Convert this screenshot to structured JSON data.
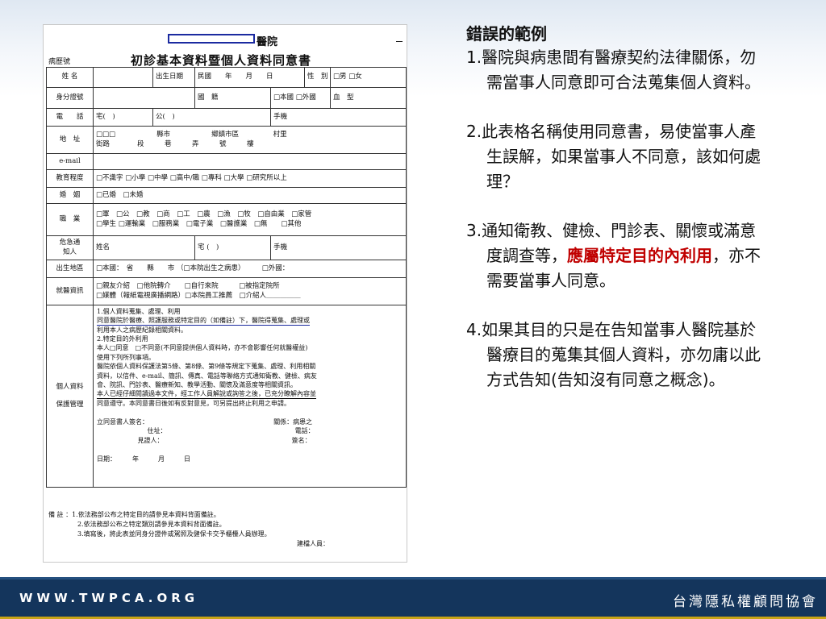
{
  "form": {
    "hospital_suffix": "醫院",
    "chart_no_label": "病歷號",
    "title": "初診基本資料暨個人資料同意書",
    "rows": {
      "name": {
        "label": "姓 名",
        "birth_label": "出生日期",
        "birth_value": "民國　　年　　月　　日",
        "sex_label": "性　別",
        "sex_options": "□男 □女"
      },
      "id": {
        "label": "身分證號",
        "nation_label": "國　籍",
        "nation_options": "□本國 □外國",
        "blood_label": "血　型"
      },
      "phone": {
        "label": "電　　話",
        "home": "宅(　)",
        "office": "公(　)",
        "mobile": "手機"
      },
      "address": {
        "label": "地　址",
        "line1": "□□□　　　　　　縣市　　　　　　鄉鎮市區　　　　　村里",
        "line2": "街路　　　　段　　　巷　　　弄　　　號　　　樓"
      },
      "email": {
        "label": "e-mail"
      },
      "education": {
        "label": "教育程度",
        "options": "□不識字 □小學 □中學 □高中/職 □專科 □大學 □研究所以上"
      },
      "marriage": {
        "label": "婚　姻",
        "options": "□已婚　□未婚"
      },
      "occupation": {
        "label": "職　業",
        "line1": "□軍　□公　□教　□商　□工　□農　□漁　□牧　□自由業　□家管",
        "line2": "□學生 □運輸業　□服務業　□電子業　□醫護業　□無　　□其他"
      },
      "emergency": {
        "label1": "危急通",
        "label2": "知人",
        "name_label": "姓名",
        "home_label": "宅",
        "home_value": "(　)",
        "mobile_label": "手機"
      },
      "birthplace": {
        "label": "出生地區",
        "value": "□本國：　省　　縣　　市 （□本院出生之病患）　　　□外國："
      },
      "consult": {
        "label": "就醫資訊",
        "line1": "□親友介紹　□他院轉介　　□自行來院　　　□被指定院所",
        "line2": "□媒體（報紙電視廣播網路）□本院員工推薦　□介紹人＿＿＿＿＿"
      },
      "pd": {
        "label1": "個人資料",
        "label2": "保護管理",
        "lines": [
          "1.個人資料蒐集、處理、利用",
          "同意醫院於醫療、照護服務或特定目的（如備註）下，醫院得蒐集、處理或",
          "利用本人之病歷紀錄相關資料。",
          "2.特定目的外利用",
          "本人□同意　□不同意(不同意提供個人資料時，亦不會影響任何就醫權益)",
          "使用下列所列事項。",
          "醫院依個人資料保護法第5條、第8條、第9條等規定下蒐集、處理、利用相關",
          "資料，以信件、e-mail、簡訊、傳真、電話等聯絡方式通知衛教、健檢、病友",
          "會、院訊、門診表、醫療新知、教學活動、關懷及滿意度等相關資訊。",
          "本人已經仔細閱讀過本文件，經工作人員解說或詢答之後，已充分瞭解內容並",
          "同意遵守。本同意書日後如有反對意見，可另提出終止利用之申請。"
        ],
        "signer_label": "立同意書人簽名：",
        "relation_label": "關係：病患之",
        "address_label": "住址：",
        "phone_label": "電話：",
        "witness_label": "見證人：",
        "sign_label": "簽名：",
        "date_label": "日期：　　　年　　　月　　　日"
      }
    },
    "notes": [
      "備 註 ：1.依法務部公布之特定目的請參見本資料背面備註。",
      "2.依法務部公布之特定類別請參見本資料背面備註。",
      "3.填寫後，將此表並同身分證件或駕照及健保卡交予櫃檯人員辦理。"
    ],
    "builder_label": "建檔人員："
  },
  "panel": {
    "heading": "錯誤的範例",
    "item1": "1.醫院與病患間有醫療契約法律關係，勿需當事人同意即可合法蒐集個人資料。",
    "item2": "2.此表格名稱使用同意書，易使當事人產生誤解，如果當事人不同意，該如何處理？",
    "item3_pre": "3.通知衛教、健檢、門診表、關懷或滿意度調查等，",
    "item3_hl": "應屬特定目的內利用",
    "item3_post": "，亦不需要當事人同意。",
    "item4": "4.如果其目的只是在告知當事人醫院基於醫療目的蒐集其個人資料，亦勿庸以此方式告知(告知沒有同意之概念)。"
  },
  "footer": {
    "url": "WWW.TWPCA.ORG",
    "org": "台灣隱私權顧問協會"
  },
  "colors": {
    "footer_bg": "#14355c",
    "footer_gold": "#c8a415",
    "highlight": "#c00000",
    "annotation_blue": "#1b2aa0"
  }
}
